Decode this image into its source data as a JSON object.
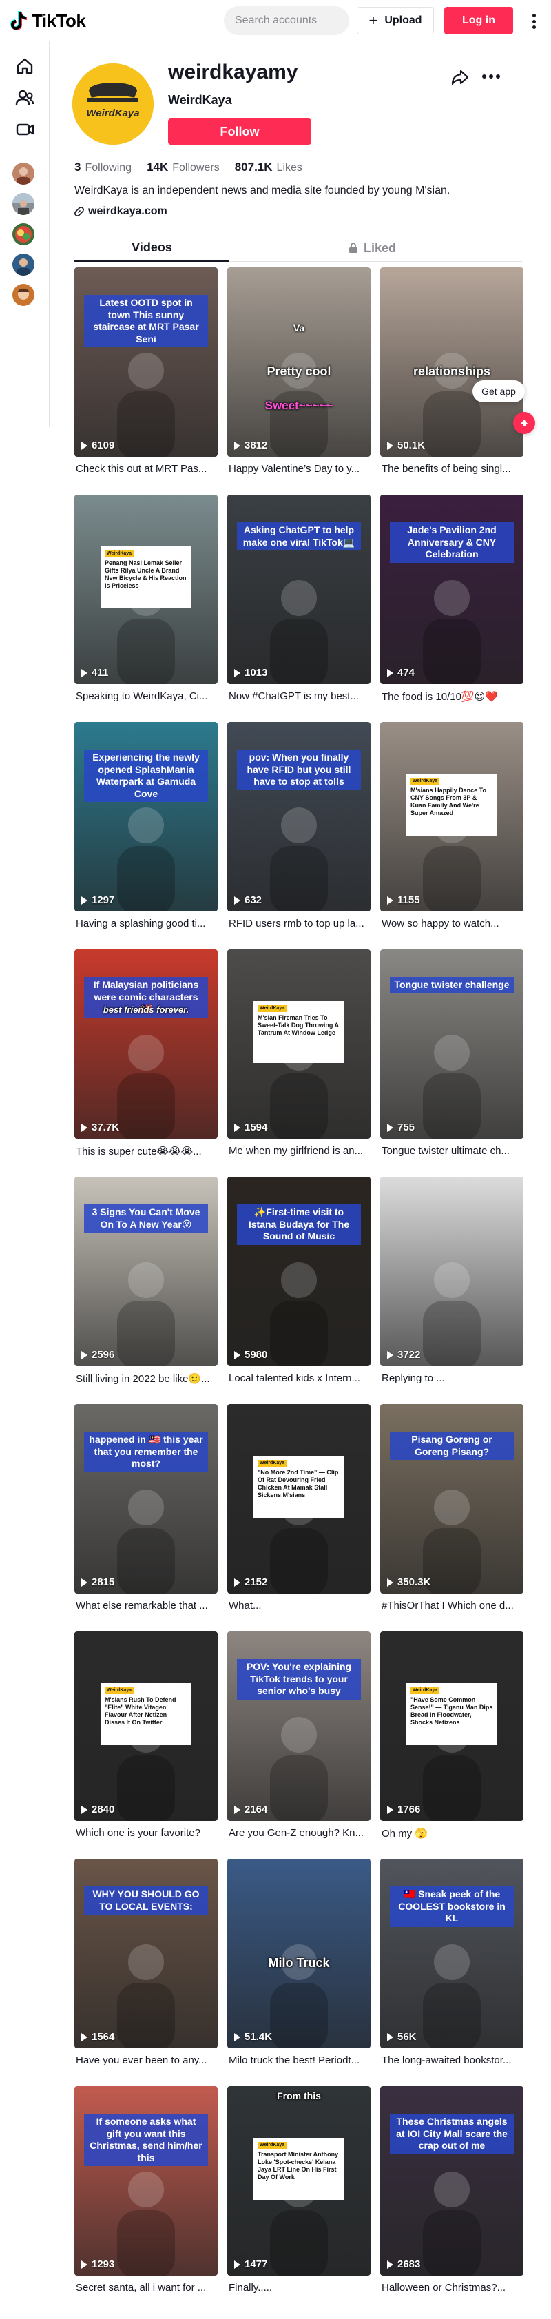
{
  "topbar": {
    "brand": "TikTok",
    "search_placeholder": "Search accounts",
    "upload_label": "Upload",
    "login_label": "Log in"
  },
  "sidenav": {
    "icons": [
      "home-icon",
      "following-icon",
      "live-icon"
    ],
    "avatars": 5
  },
  "profile": {
    "username": "weirdkayamy",
    "display_name": "WeirdKaya",
    "avatar_text": "WeirdKaya",
    "follow_label": "Follow",
    "following_count": "3",
    "following_label": "Following",
    "followers_count": "14K",
    "followers_label": "Followers",
    "likes_count": "807.1K",
    "likes_label": "Likes",
    "bio": "WeirdKaya is an independent news and media site founded by young M'sian.",
    "link": "weirdkaya.com"
  },
  "tabs": {
    "videos": "Videos",
    "liked": "Liked"
  },
  "floating": {
    "get_app": "Get app"
  },
  "videos": [
    {
      "views": "6109",
      "caption": "Check this out at MRT Pas...",
      "overlay": "Latest OOTD spot in town This sunny staircase at MRT Pasar Seni",
      "bg": "#6d5b55"
    },
    {
      "views": "3812",
      "caption": "Happy Valentine’s Day to y...",
      "overlay": "Pretty cool",
      "overlay_small": "Va",
      "overlay_pink": "Sweet~~~~~",
      "bg": "#a79e94"
    },
    {
      "views": "50.1K",
      "caption": "The benefits of being singl...",
      "overlay": "relationships",
      "bg": "#b7a69a"
    },
    {
      "views": "411",
      "caption": "Speaking to WeirdKaya, Ci...",
      "news_brand": "WeirdKaya",
      "news_headline": "Penang Nasi Lemak Seller Gifts Rilya Uncle A Brand New Bicycle & His Reaction Is Priceless",
      "bg": "#7b8c8e"
    },
    {
      "views": "1013",
      "caption": "Now #ChatGPT is my best...",
      "overlay": "Asking ChatGPT to help make one viral TikTok💻",
      "bg": "#3a3f44"
    },
    {
      "views": "474",
      "caption": "The food is 10/10💯😍❤️",
      "overlay": "Jade's Pavilion 2nd Anniversary & CNY Celebration",
      "bg": "#3b1f3f"
    },
    {
      "views": "1297",
      "caption": "Having a splashing good ti...",
      "overlay": "Experiencing the newly opened SplashMania Waterpark at Gamuda Cove",
      "bg": "#2d7a8e"
    },
    {
      "views": "632",
      "caption": "RFID users rmb to top up la...",
      "overlay": "pov: When you finally have RFID but you still have to stop at tolls",
      "bg": "#424a55"
    },
    {
      "views": "1155",
      "caption": "Wow so happy to watch...",
      "news_brand": "WeirdKaya",
      "news_headline": "M'sians Happily Dance To CNY Songs From 3P & Kuan Family And We're Super Amazed",
      "bg": "#9a8f86"
    },
    {
      "views": "37.7K",
      "caption": "This is super cute😭😭😭...",
      "overlay": "If Malaysian politicians were comic characters🇲🇾",
      "overlay_script": "best friends forever.",
      "bg": "#c83a2c"
    },
    {
      "views": "1594",
      "caption": "Me when my girlfriend is an...",
      "news_brand": "WeirdKaya",
      "news_headline": "M'sian Fireman Tries To Sweet-Talk Dog Throwing A Tantrum At Window Ledge",
      "bg": "#4e4c4a"
    },
    {
      "views": "755",
      "caption": "Tongue twister ultimate ch...",
      "overlay": "Tongue twister challenge",
      "bg": "#8a8884"
    },
    {
      "views": "2596",
      "caption": "Still living in 2022 be like🙂...",
      "overlay": "3 Signs You Can't Move On To A New Year😮",
      "bg": "#c7c2b9"
    },
    {
      "views": "5980",
      "caption": "Local talented kids x Intern...",
      "overlay": "✨First-time visit to Istana Budaya for The Sound of Music",
      "bg": "#2a2520"
    },
    {
      "views": "3722",
      "caption": "Replying to ...",
      "bg": "#dcdcdc"
    },
    {
      "views": "2815",
      "caption": "What else remarkable that ...",
      "overlay": "happened in 🇲🇾 this year that you remember the most?",
      "bg": "#6b6966"
    },
    {
      "views": "2152",
      "caption": "What...",
      "news_brand": "WeirdKaya",
      "news_headline": "\"No More 2nd Time\" — Clip Of Rat Devouring Fried Chicken At Mamak Stall Sickens M'sians",
      "bg": "#2b2b2b"
    },
    {
      "views": "350.3K",
      "caption": "#ThisOrThat I Which one d...",
      "overlay": "Pisang Goreng or Goreng Pisang?",
      "bg": "#7a6f60"
    },
    {
      "views": "2840",
      "caption": "Which one is your favorite?",
      "news_brand": "WeirdKaya",
      "news_headline": "M'sians Rush To Defend \"Elite\" White Vitagen Flavour After Netizen Disses It On Twitter",
      "bg": "#2b2b2b"
    },
    {
      "views": "2164",
      "caption": "Are you Gen-Z enough? Kn...",
      "overlay": "POV: You're explaining TikTok trends to your senior who's busy",
      "bg": "#8d8580"
    },
    {
      "views": "1766",
      "caption": "Oh my 🫣",
      "news_brand": "WeirdKaya",
      "news_headline": "\"Have Some Common Sense!\" — T'ganu Man Dips Bread In Floodwater, Shocks Netizens",
      "bg": "#2b2b2b"
    },
    {
      "views": "1564",
      "caption": "Have you ever been to any...",
      "overlay": "WHY YOU SHOULD GO TO LOCAL EVENTS:",
      "bg": "#6a5548"
    },
    {
      "views": "51.4K",
      "caption": "Milo truck the best! Periodt...",
      "overlay": "Milo Truck",
      "bg": "#3a5a86"
    },
    {
      "views": "56K",
      "caption": "The long-awaited bookstor...",
      "overlay": "🇹🇼 Sneak peek of the COOLEST bookstore in KL",
      "bg": "#51555c"
    },
    {
      "views": "1293",
      "caption": "Secret santa, all i want for ...",
      "overlay": "If someone asks what gift you want this Christmas, send him/her this",
      "bg": "#c25b4f"
    },
    {
      "views": "1477",
      "caption": "Finally.....",
      "overlay_top": "From this",
      "news_brand": "WeirdKaya",
      "news_headline": "Transport Minister Anthony Loke 'Spot-checks' Kelana Jaya LRT Line On His First Day Of Work",
      "bg": "#2f3437"
    },
    {
      "views": "2683",
      "caption": "Halloween or Christmas?...",
      "overlay": "These Christmas angels at IOI City Mall scare the crap out of me",
      "bg": "#3a2f40"
    }
  ]
}
